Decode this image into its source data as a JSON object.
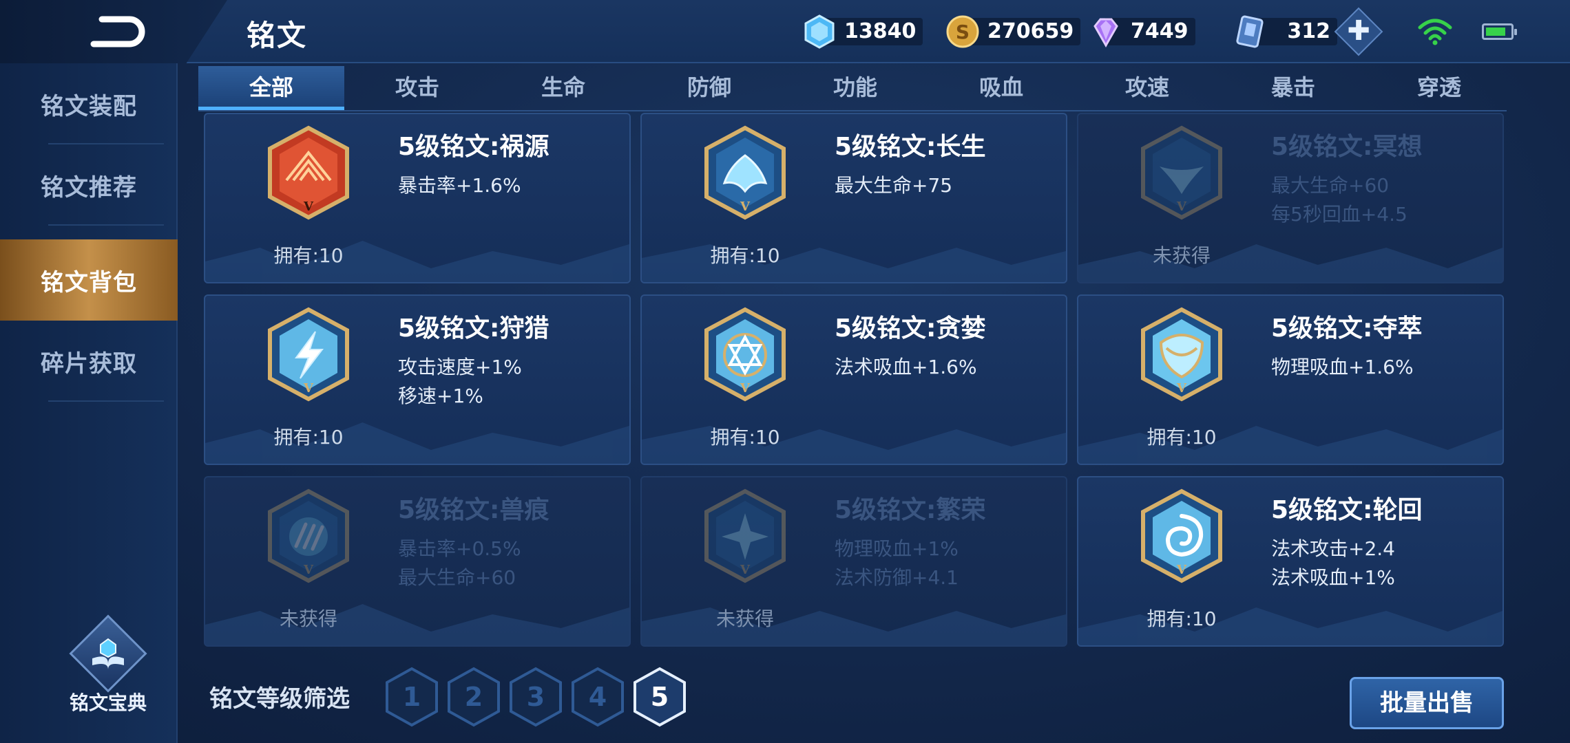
{
  "header": {
    "title": "铭文",
    "back_icon": "back-arrow-icon",
    "currencies": [
      {
        "name": "crystal-icon",
        "value": "13840",
        "color": "#56c4ff"
      },
      {
        "name": "gold-coin-icon",
        "value": "270659",
        "color": "#e7b34a"
      },
      {
        "name": "diamond-icon",
        "value": "7449",
        "color": "#b889ff"
      },
      {
        "name": "voucher-card-icon",
        "value": "312",
        "color": "#8fb9f2"
      }
    ],
    "add_label": "✚"
  },
  "sidebar": {
    "items": [
      {
        "label": "铭文装配",
        "active": false
      },
      {
        "label": "铭文推荐",
        "active": false
      },
      {
        "label": "铭文背包",
        "active": true
      },
      {
        "label": "碎片获取",
        "active": false
      }
    ],
    "codex_label": "铭文宝典"
  },
  "tabs": [
    "全部",
    "攻击",
    "生命",
    "防御",
    "功能",
    "吸血",
    "攻速",
    "暴击",
    "穿透"
  ],
  "active_tab": "全部",
  "cards": [
    {
      "name": "5级铭文:祸源",
      "attrs": [
        "暴击率+1.6%"
      ],
      "own": "拥有:10",
      "owned": true,
      "icon": "red-fan-rune-icon"
    },
    {
      "name": "5级铭文:长生",
      "attrs": [
        "最大生命+75"
      ],
      "own": "拥有:10",
      "owned": true,
      "icon": "blue-lotus-rune-icon"
    },
    {
      "name": "5级铭文:冥想",
      "attrs": [
        "最大生命+60",
        "每5秒回血+4.5"
      ],
      "own": "未获得",
      "owned": false,
      "icon": "blue-bird-rune-icon"
    },
    {
      "name": "5级铭文:狩猎",
      "attrs": [
        "攻击速度+1%",
        "移速+1%"
      ],
      "own": "拥有:10",
      "owned": true,
      "icon": "lightning-rune-icon"
    },
    {
      "name": "5级铭文:贪婪",
      "attrs": [
        "法术吸血+1.6%"
      ],
      "own": "拥有:10",
      "owned": true,
      "icon": "star-circle-rune-icon"
    },
    {
      "name": "5级铭文:夺萃",
      "attrs": [
        "物理吸血+1.6%"
      ],
      "own": "拥有:10",
      "owned": true,
      "icon": "knot-rune-icon"
    },
    {
      "name": "5级铭文:兽痕",
      "attrs": [
        "暴击率+0.5%",
        "最大生命+60"
      ],
      "own": "未获得",
      "owned": false,
      "icon": "claw-rune-icon"
    },
    {
      "name": "5级铭文:繁荣",
      "attrs": [
        "物理吸血+1%",
        "法术防御+4.1"
      ],
      "own": "未获得",
      "owned": false,
      "icon": "flower-rune-icon"
    },
    {
      "name": "5级铭文:轮回",
      "attrs": [
        "法术攻击+2.4",
        "法术吸血+1%"
      ],
      "own": "拥有:10",
      "owned": true,
      "icon": "vortex-rune-icon"
    }
  ],
  "filter": {
    "label": "铭文等级筛选",
    "levels": [
      "1",
      "2",
      "3",
      "4",
      "5"
    ],
    "active_level": "5"
  },
  "sell_button": "批量出售",
  "rune_tier_mark": "V",
  "colors": {
    "accent": "#4fb1ff",
    "gold": "#c4904a",
    "frame_gold": "#c8a160"
  }
}
